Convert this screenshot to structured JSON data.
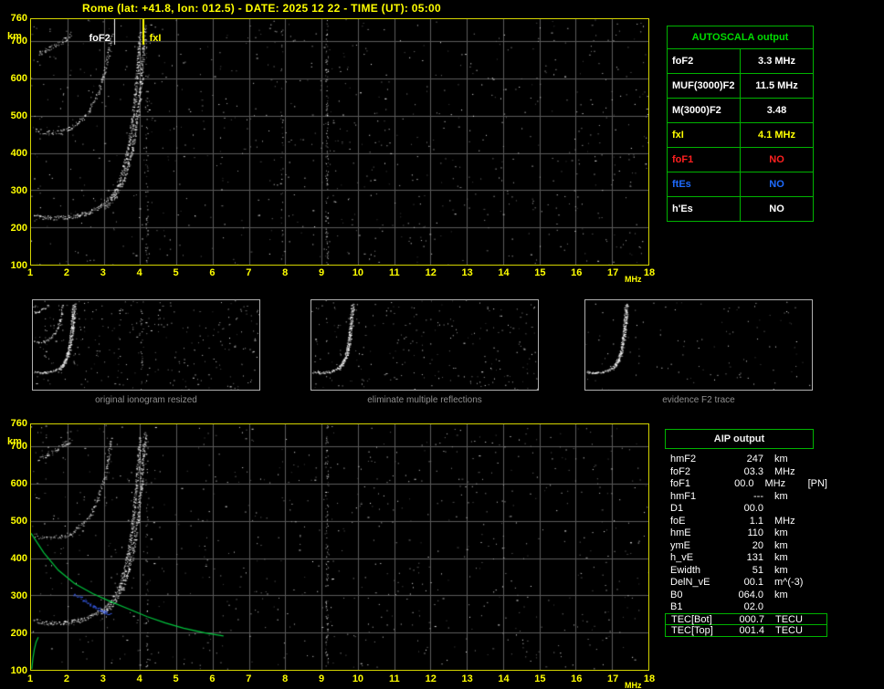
{
  "title": "Rome (lat: +41.8, lon: 012.5) - DATE: 2025 12 22 - TIME (UT): 05:00",
  "colors": {
    "yellow": "#ffff00",
    "green": "#00b400",
    "red": "#ff2020",
    "blue": "#1e6bff",
    "white": "#ffffff",
    "grid": "#5a5a5a",
    "caption_gray": "#8f8f8f",
    "plot_border": "#d4d400"
  },
  "autoscala": {
    "header": "AUTOSCALA output",
    "rows": [
      {
        "label": "foF2",
        "value": "3.3 MHz",
        "color": "#ffffff"
      },
      {
        "label": "MUF(3000)F2",
        "value": "11.5 MHz",
        "color": "#ffffff"
      },
      {
        "label": "M(3000)F2",
        "value": "3.48",
        "color": "#ffffff"
      },
      {
        "label": "fxI",
        "value": "4.1 MHz",
        "color": "#ffff00"
      },
      {
        "label": "foF1",
        "value": "NO",
        "color": "#ff2020"
      },
      {
        "label": "ftEs",
        "value": "NO",
        "color": "#1e6bff"
      },
      {
        "label": "h'Es",
        "value": "NO",
        "color": "#ffffff"
      }
    ]
  },
  "aip": {
    "header": "AIP output",
    "rows": [
      {
        "label": "hmF2",
        "value": "247",
        "unit": "km",
        "note": ""
      },
      {
        "label": "foF2",
        "value": "03.3",
        "unit": "MHz",
        "note": ""
      },
      {
        "label": "foF1",
        "value": "00.0",
        "unit": "MHz",
        "note": "[PN]"
      },
      {
        "label": "hmF1",
        "value": "---",
        "unit": "km",
        "note": ""
      },
      {
        "label": "D1",
        "value": "00.0",
        "unit": "",
        "note": ""
      },
      {
        "label": "foE",
        "value": "1.1",
        "unit": "MHz",
        "note": ""
      },
      {
        "label": "hmE",
        "value": "110",
        "unit": "km",
        "note": ""
      },
      {
        "label": "ymE",
        "value": "20",
        "unit": "km",
        "note": ""
      },
      {
        "label": "h_vE",
        "value": "131",
        "unit": "km",
        "note": ""
      },
      {
        "label": "Ewidth",
        "value": "51",
        "unit": "km",
        "note": ""
      },
      {
        "label": "DelN_vE",
        "value": "00.1",
        "unit": "m^(-3)",
        "note": ""
      },
      {
        "label": "B0",
        "value": "064.0",
        "unit": "km",
        "note": ""
      },
      {
        "label": "B1",
        "value": "02.0",
        "unit": "",
        "note": ""
      },
      {
        "label": "TEC[Bot]",
        "value": "000.7",
        "unit": "TECU",
        "note": "",
        "boxed": true
      },
      {
        "label": "TEC[Top]",
        "value": "001.4",
        "unit": "TECU",
        "note": "",
        "boxed": true
      }
    ]
  },
  "thumbnails": [
    {
      "caption": "original ionogram resized",
      "noise_dots": 300,
      "trace_indices": [
        0,
        1,
        2,
        3
      ],
      "interference": [
        {
          "f": 9.14,
          "count": 25,
          "spread": 1.0
        }
      ]
    },
    {
      "caption": "eliminate multiple reflections",
      "noise_dots": 250,
      "trace_indices": [
        0,
        1
      ],
      "interference": []
    },
    {
      "caption": "evidence F2 trace",
      "noise_dots": 110,
      "trace_indices": [
        0,
        1
      ],
      "interference": []
    }
  ],
  "chart_data": [
    {
      "type": "scatter",
      "name": "ionogram-top",
      "title": "",
      "xlabel": "MHz",
      "ylabel": "km",
      "xlim": [
        1,
        18
      ],
      "ylim": [
        100,
        760
      ],
      "x_ticks": [
        1,
        2,
        3,
        4,
        5,
        6,
        7,
        8,
        9,
        10,
        11,
        12,
        13,
        14,
        15,
        16,
        17,
        18
      ],
      "y_ticks": [
        760,
        700,
        600,
        500,
        400,
        300,
        200,
        100
      ],
      "grid": true,
      "noise_dots": 850,
      "interference_lines": [
        {
          "f": 9.14,
          "count": 140,
          "spread": 1.5
        },
        {
          "f": 4.18,
          "count": 70,
          "spread": 1.2
        },
        {
          "f": 7.9,
          "count": 35,
          "spread": 1.2
        }
      ],
      "markers": [
        {
          "label": "foF2",
          "freq": 3.3,
          "color": "#ffffff",
          "width": 1,
          "label_side": "left"
        },
        {
          "label": "fxI",
          "freq": 4.1,
          "color": "#ffff00",
          "width": 2,
          "label_side": "right"
        }
      ],
      "traces": [
        {
          "name": "F2-trace-ordinary",
          "color": "#ffffff",
          "density": 3,
          "jitter": 2.2,
          "points": [
            [
              1.1,
              232
            ],
            [
              1.5,
              226
            ],
            [
              1.9,
              227
            ],
            [
              2.3,
              233
            ],
            [
              2.65,
              243
            ],
            [
              2.95,
              260
            ],
            [
              3.2,
              285
            ],
            [
              3.4,
              318
            ],
            [
              3.55,
              362
            ],
            [
              3.68,
              418
            ],
            [
              3.78,
              485
            ],
            [
              3.86,
              560
            ],
            [
              3.93,
              640
            ],
            [
              3.99,
              720
            ]
          ]
        },
        {
          "name": "F2-trace-extraordinary",
          "color": "#ffffff",
          "density": 3,
          "jitter": 2.2,
          "points": [
            [
              3.05,
              256
            ],
            [
              3.3,
              284
            ],
            [
              3.5,
              320
            ],
            [
              3.68,
              370
            ],
            [
              3.82,
              432
            ],
            [
              3.93,
              508
            ],
            [
              4.02,
              592
            ],
            [
              4.09,
              682
            ],
            [
              4.13,
              735
            ]
          ]
        },
        {
          "name": "second-hop-multiple",
          "color": "#ffffff",
          "density": 2,
          "jitter": 2.5,
          "points": [
            [
              1.1,
              462
            ],
            [
              1.45,
              455
            ],
            [
              1.8,
              458
            ],
            [
              2.1,
              469
            ],
            [
              2.4,
              490
            ],
            [
              2.65,
              522
            ],
            [
              2.85,
              562
            ],
            [
              3.0,
              612
            ],
            [
              3.12,
              668
            ],
            [
              3.2,
              718
            ]
          ]
        },
        {
          "name": "third-hop-multiple",
          "color": "#ffffff",
          "density": 2,
          "jitter": 2.5,
          "points": [
            [
              1.2,
              668
            ],
            [
              1.45,
              679
            ],
            [
              1.7,
              692
            ],
            [
              1.92,
              706
            ],
            [
              2.08,
              720
            ]
          ]
        }
      ]
    },
    {
      "type": "scatter",
      "name": "ionogram-bottom",
      "title": "",
      "xlabel": "MHz",
      "ylabel": "km",
      "xlim": [
        1,
        18
      ],
      "ylim": [
        100,
        760
      ],
      "x_ticks": [
        1,
        2,
        3,
        4,
        5,
        6,
        7,
        8,
        9,
        10,
        11,
        12,
        13,
        14,
        15,
        16,
        17,
        18
      ],
      "y_ticks": [
        760,
        700,
        600,
        500,
        400,
        300,
        200,
        100
      ],
      "grid": true,
      "noise_dots": 800,
      "interference_lines": [
        {
          "f": 9.14,
          "count": 120,
          "spread": 1.5
        },
        {
          "f": 4.18,
          "count": 55,
          "spread": 1.2
        }
      ],
      "traces": [
        {
          "name": "F2-trace-ordinary",
          "color": "#ffffff",
          "density": 3,
          "jitter": 2.2,
          "points": [
            [
              1.1,
              232
            ],
            [
              1.5,
              226
            ],
            [
              1.9,
              227
            ],
            [
              2.3,
              233
            ],
            [
              2.65,
              243
            ],
            [
              2.95,
              260
            ],
            [
              3.2,
              285
            ],
            [
              3.4,
              318
            ],
            [
              3.55,
              362
            ],
            [
              3.68,
              418
            ],
            [
              3.78,
              485
            ],
            [
              3.86,
              560
            ],
            [
              3.93,
              640
            ],
            [
              3.99,
              720
            ]
          ]
        },
        {
          "name": "F2-trace-extraordinary",
          "color": "#ffffff",
          "density": 3,
          "jitter": 2.2,
          "points": [
            [
              3.05,
              256
            ],
            [
              3.3,
              284
            ],
            [
              3.5,
              320
            ],
            [
              3.68,
              370
            ],
            [
              3.82,
              432
            ],
            [
              3.93,
              508
            ],
            [
              4.02,
              592
            ],
            [
              4.09,
              682
            ],
            [
              4.13,
              735
            ]
          ]
        },
        {
          "name": "second-hop-multiple",
          "color": "#ffffff",
          "density": 2,
          "jitter": 2.5,
          "points": [
            [
              1.1,
              462
            ],
            [
              1.45,
              455
            ],
            [
              1.8,
              458
            ],
            [
              2.1,
              469
            ],
            [
              2.4,
              490
            ],
            [
              2.65,
              522
            ],
            [
              2.85,
              562
            ],
            [
              3.0,
              612
            ],
            [
              3.12,
              668
            ],
            [
              3.2,
              718
            ]
          ]
        },
        {
          "name": "third-hop-multiple",
          "color": "#ffffff",
          "density": 2,
          "jitter": 2.5,
          "points": [
            [
              1.2,
              668
            ],
            [
              1.45,
              679
            ],
            [
              1.7,
              692
            ],
            [
              1.92,
              706
            ],
            [
              2.08,
              720
            ]
          ]
        },
        {
          "name": "restored-trace-points",
          "color": "#3c64ff",
          "density": 2,
          "jitter": 1.5,
          "size": 2,
          "points": [
            [
              2.2,
              302
            ],
            [
              2.45,
              287
            ],
            [
              2.7,
              272
            ],
            [
              2.9,
              261
            ],
            [
              3.05,
              254
            ],
            [
              3.15,
              250
            ]
          ]
        }
      ],
      "profile_curves": [
        {
          "name": "reconstructed-profile",
          "color": "#00c43c",
          "points": [
            [
              1.0,
              467
            ],
            [
              1.35,
              415
            ],
            [
              1.75,
              368
            ],
            [
              2.2,
              332
            ],
            [
              2.7,
              305
            ],
            [
              3.2,
              283
            ],
            [
              3.7,
              263
            ],
            [
              4.2,
              243
            ],
            [
              4.7,
              226
            ],
            [
              5.2,
              212
            ],
            [
              5.8,
              199
            ],
            [
              6.3,
              191
            ]
          ]
        },
        {
          "name": "e-region-profile",
          "color": "#00c43c",
          "points": [
            [
              1.02,
              102
            ],
            [
              1.05,
              130
            ],
            [
              1.09,
              155
            ],
            [
              1.14,
              175
            ],
            [
              1.2,
              188
            ]
          ]
        }
      ]
    }
  ]
}
